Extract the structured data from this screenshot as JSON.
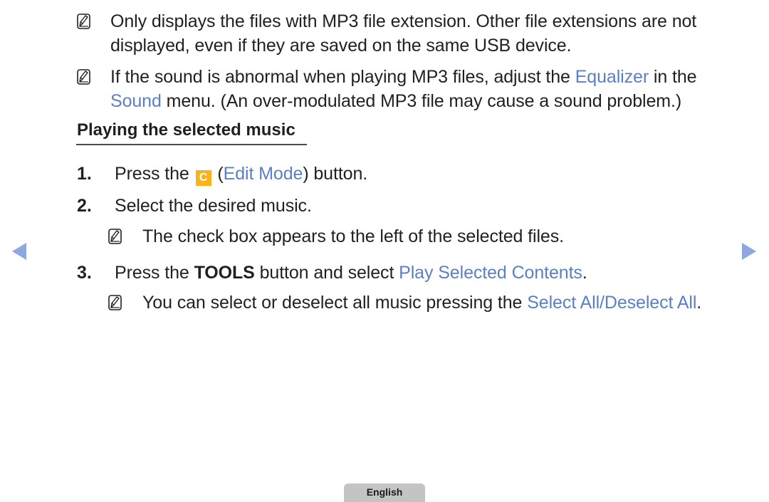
{
  "notes_top": [
    {
      "icon": "note-icon",
      "lines": [
        {
          "text": "Only displays the files with MP3 file extension. Other file extensions are not"
        },
        {
          "text": "displayed, even if they are saved on the same USB device."
        }
      ]
    },
    {
      "icon": "note-icon",
      "line1": {
        "before": "If the sound is abnormal when playing MP3 files, adjust the ",
        "highlight": "Equalizer",
        "after": " in the"
      },
      "line2": {
        "highlight": "Sound",
        "after": " menu. (An over-modulated MP3 file may cause a sound problem.)"
      }
    }
  ],
  "section": {
    "heading": "Playing the selected music"
  },
  "steps": [
    {
      "number": "1.",
      "before": "Press the ",
      "key_label": "C",
      "paren_open": " (",
      "highlight": "Edit Mode",
      "after": ") button."
    },
    {
      "number": "2.",
      "text": "Select the desired music.",
      "note": "The check box appears to the left of the selected files."
    },
    {
      "number": "3.",
      "before": "Press the ",
      "bold": "TOOLS",
      "middle": " button and select ",
      "highlight": "Play Selected Contents",
      "after": ".",
      "note": {
        "before": "You can select or deselect all music pressing the ",
        "highlight": "Select All/Deselect All",
        "after": "."
      }
    }
  ],
  "navigation": {
    "prev_icon": "triangle-left-icon",
    "next_icon": "triangle-right-icon"
  },
  "footer": {
    "language_label": "English"
  },
  "colors": {
    "highlight": "#5b7fc4",
    "key_c": "#f9b21c",
    "nav_arrow": "#8ea7e0",
    "lang_tab": "#c4c4c4",
    "text": "#231f20"
  }
}
